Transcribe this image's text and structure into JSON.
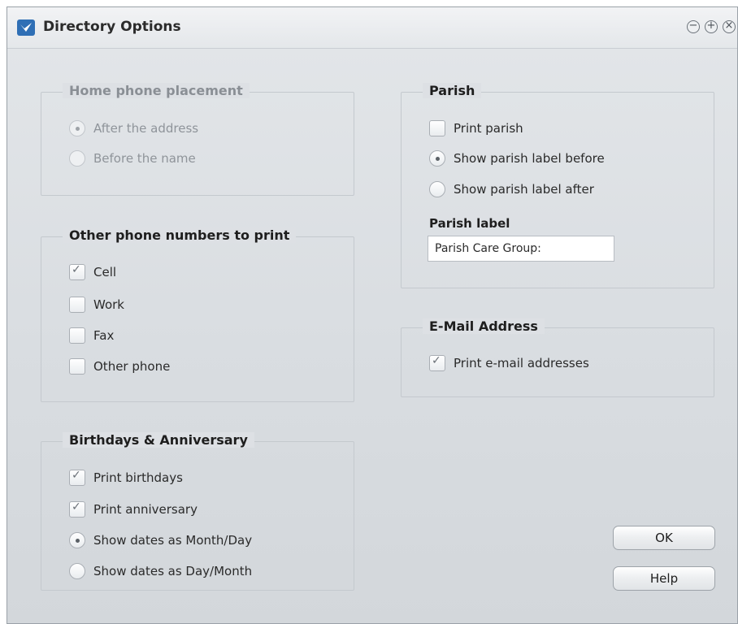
{
  "window": {
    "title": "Directory Options",
    "controls": {
      "minimize": "−",
      "maximize": "+",
      "close": "×"
    }
  },
  "home_phone": {
    "legend": "Home phone placement",
    "options": [
      {
        "label": "After the address",
        "selected": true
      },
      {
        "label": "Before the name",
        "selected": false
      }
    ]
  },
  "other_phones": {
    "legend": "Other phone numbers to print",
    "options": [
      {
        "label": "Cell",
        "checked": true
      },
      {
        "label": "Work",
        "checked": false
      },
      {
        "label": "Fax",
        "checked": false
      },
      {
        "label": "Other phone",
        "checked": false
      }
    ]
  },
  "birthdays": {
    "legend": "Birthdays & Anniversary",
    "options": [
      {
        "label": "Print birthdays",
        "checked": true
      },
      {
        "label": "Print anniversary",
        "checked": true
      },
      {
        "label": "Show dates as Month/Day",
        "selected": true
      },
      {
        "label": "Show dates as Day/Month",
        "selected": false
      }
    ]
  },
  "parish": {
    "legend": "Parish",
    "print_parish": {
      "label": "Print parish",
      "checked": false
    },
    "label_before": {
      "label": "Show parish label before",
      "selected": true
    },
    "label_after": {
      "label": "Show parish label after",
      "selected": false
    },
    "parish_label_title": "Parish label",
    "parish_label_value": "Parish Care Group:"
  },
  "email": {
    "legend": "E-Mail Address",
    "print_email": {
      "label": "Print e-mail addresses",
      "checked": true
    }
  },
  "buttons": {
    "ok": "OK",
    "help": "Help"
  },
  "icons": {
    "check": "✓"
  },
  "colors": {
    "app_icon": "#2f6fb5"
  }
}
